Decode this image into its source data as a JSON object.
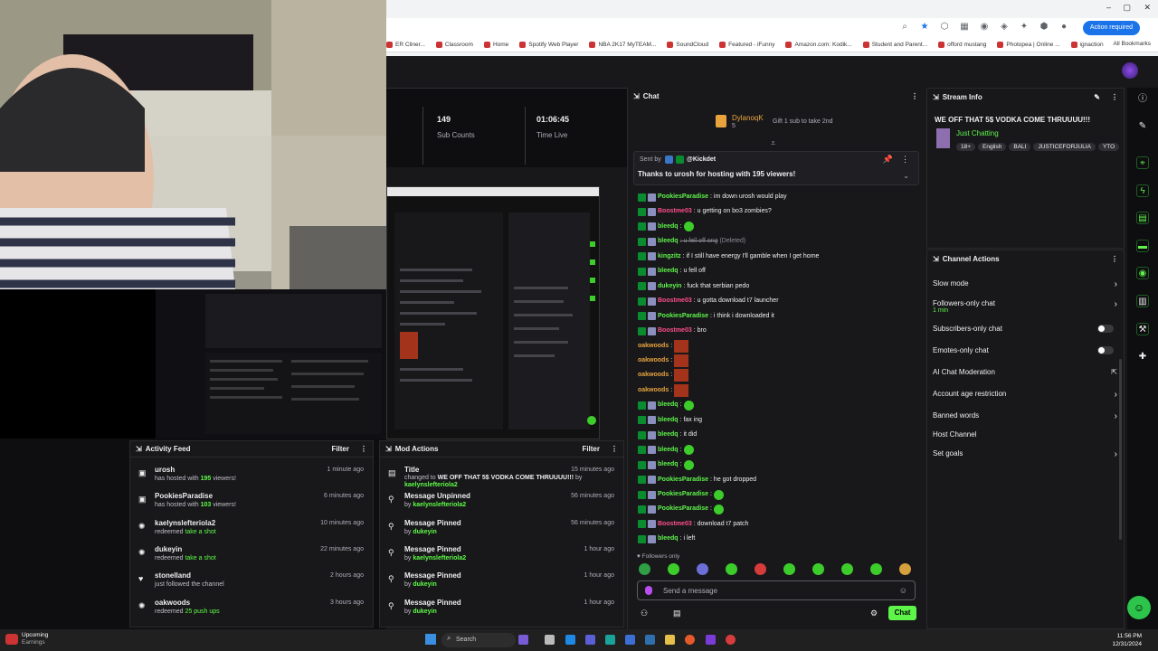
{
  "browser": {
    "action_label": "Action required",
    "bookmarks": [
      "ER Cliner...",
      "Classroom",
      "Home",
      "Spotify Web Player",
      "NBA 2K17 MyTEAM...",
      "SoundCloud",
      "Featured - iFunny",
      "Amazon.com: Kodik...",
      "Student and Parent...",
      "offord mustang",
      "Photopea | Online ...",
      "ignaction"
    ],
    "all_bookmarks": "All Bookmarks"
  },
  "stats": {
    "subs_value": "149",
    "subs_label": "Sub Counts",
    "time_value": "01:06:45",
    "time_label": "Time Live"
  },
  "activity_feed": {
    "title": "Activity Feed",
    "filter": "Filter",
    "items": [
      {
        "who": "urosh",
        "pre": "has hosted with ",
        "num": "195",
        "post": " viewers!",
        "time": "1 minute ago",
        "icon": "host-icon"
      },
      {
        "who": "PookiesParadise",
        "pre": "has hosted with ",
        "num": "103",
        "post": " viewers!",
        "time": "6 minutes ago",
        "icon": "host-icon"
      },
      {
        "who": "kaelynslefteriola2",
        "pre": "redeemed ",
        "num": "take a shot",
        "post": "",
        "time": "10 minutes ago",
        "icon": "points-icon"
      },
      {
        "who": "dukeyin",
        "pre": "redeemed ",
        "num": "take a shot",
        "post": "",
        "time": "22 minutes ago",
        "icon": "points-icon"
      },
      {
        "who": "stonelland",
        "pre": "just followed the channel",
        "num": "",
        "post": "",
        "time": "2 hours ago",
        "icon": "heart-icon"
      },
      {
        "who": "oakwoods",
        "pre": "redeemed ",
        "num": "25 push ups",
        "post": "",
        "time": "3 hours ago",
        "icon": "points-icon"
      }
    ]
  },
  "mod_actions": {
    "title": "Mod Actions",
    "filter": "Filter",
    "items": [
      {
        "title": "Title",
        "l1": "changed to ",
        "l1b": "WE OFF THAT 5$ VODKA COME THRUUUU!!!",
        "l1c": " by",
        "by": "kaelynslefteriola2",
        "time": "15 minutes ago"
      },
      {
        "title": "Message Unpinned",
        "l1": "by ",
        "l1b": "",
        "l1c": "",
        "by": "kaelynslefteriola2",
        "time": "56 minutes ago"
      },
      {
        "title": "Message Pinned",
        "l1": "by ",
        "l1b": "",
        "l1c": "",
        "by": "dukeyin",
        "time": "56 minutes ago"
      },
      {
        "title": "Message Pinned",
        "l1": "by ",
        "l1b": "",
        "l1c": "",
        "by": "kaelynslefteriola2",
        "time": "1 hour ago"
      },
      {
        "title": "Message Pinned",
        "l1": "by ",
        "l1b": "",
        "l1c": "",
        "by": "dukeyin",
        "time": "1 hour ago"
      },
      {
        "title": "Message Pinned",
        "l1": "by ",
        "l1b": "",
        "l1c": "",
        "by": "dukeyin",
        "time": "1 hour ago"
      }
    ]
  },
  "chat": {
    "title": "Chat",
    "gifter_name": "DylanoqK",
    "gifter_count": "5",
    "gift_text": "Gift 1 sub to take 2nd",
    "pinned_sent_by": "Sent by",
    "pinned_user": "@Kickdet",
    "pinned_text": "Thanks to urosh for hosting with 195 viewers!",
    "messages": [
      {
        "name": "PookiesParadise",
        "color": "#5ef44a",
        "text": ": im down urosh would play"
      },
      {
        "name": "Boostme03",
        "color": "#ff4f8b",
        "text": ": u getting on bo3 zombies?"
      },
      {
        "name": "bleedq",
        "color": "#5ef44a",
        "text": ":",
        "emote": true
      },
      {
        "name": "bleedq",
        "color": "#5ef44a",
        "text": ": u fell off ong",
        "deleted": "(Deleted)"
      },
      {
        "name": "kingzitz",
        "color": "#5ef44a",
        "text": ": if I still have energy I'll gamble when I get home"
      },
      {
        "name": "bleedq",
        "color": "#5ef44a",
        "text": ": u fell off"
      },
      {
        "name": "dukeyin",
        "color": "#5ef44a",
        "text": ": fuck that serbian pedo"
      },
      {
        "name": "Boostme03",
        "color": "#ff4f8b",
        "text": ": u gotta download t7 launcher"
      },
      {
        "name": "PookiesParadise",
        "color": "#5ef44a",
        "text": ": i think i downloaded it"
      },
      {
        "name": "Boostme03",
        "color": "#ff4f8b",
        "text": ": bro"
      },
      {
        "name": "oakwoods",
        "color": "#e8a33d",
        "text": ":",
        "img": true
      },
      {
        "name": "oakwoods",
        "color": "#e8a33d",
        "text": ":",
        "img": true
      },
      {
        "name": "oakwoods",
        "color": "#e8a33d",
        "text": ":",
        "img": true
      },
      {
        "name": "oakwoods",
        "color": "#e8a33d",
        "text": ":",
        "img": true
      },
      {
        "name": "bleedq",
        "color": "#5ef44a",
        "text": ":",
        "emote": true
      },
      {
        "name": "bleedq",
        "color": "#5ef44a",
        "text": ": fax ing"
      },
      {
        "name": "bleedq",
        "color": "#5ef44a",
        "text": ": it did"
      },
      {
        "name": "bleedq",
        "color": "#5ef44a",
        "text": ":",
        "emote": true
      },
      {
        "name": "bleedq",
        "color": "#5ef44a",
        "text": ":",
        "emote": true
      },
      {
        "name": "PookiesParadise",
        "color": "#5ef44a",
        "text": ": he got dropped"
      },
      {
        "name": "PookiesParadise",
        "color": "#5ef44a",
        "text": ":",
        "emote": true
      },
      {
        "name": "PookiesParadise",
        "color": "#5ef44a",
        "text": ":",
        "emote": true
      },
      {
        "name": "Boostme03",
        "color": "#ff4f8b",
        "text": ": download t7 patch"
      },
      {
        "name": "bleedq",
        "color": "#5ef44a",
        "text": ": i left"
      }
    ],
    "followers_only": "Followers only",
    "placeholder": "Send a message",
    "chat_button": "Chat"
  },
  "stream_info": {
    "title": "Stream Info",
    "stream_title": "WE OFF THAT 5$ VODKA COME THRUUUU!!!",
    "category": "Just Chatting",
    "tags": [
      "18+",
      "English",
      "BALI",
      "JUSTICEFORJULIA",
      "YTO"
    ]
  },
  "channel_actions": {
    "title": "Channel Actions",
    "items": [
      {
        "label": "Slow mode",
        "type": "arrow"
      },
      {
        "label": "Followers-only chat",
        "sub": "1 min",
        "type": "arrow"
      },
      {
        "label": "Subscribers-only chat",
        "type": "toggle"
      },
      {
        "label": "Emotes-only chat",
        "type": "toggle"
      },
      {
        "label": "AI Chat Moderation",
        "type": "ext"
      },
      {
        "label": "Account age restriction",
        "type": "arrow"
      },
      {
        "label": "Banned words",
        "type": "arrow"
      },
      {
        "label": "Host Channel",
        "type": "none"
      },
      {
        "label": "Set goals",
        "type": "arrow"
      }
    ]
  },
  "taskbar": {
    "weather_line1": "Upcoming",
    "weather_line2": "Earnings",
    "search": "Search",
    "time": "11:56 PM",
    "date": "12/31/2024"
  }
}
